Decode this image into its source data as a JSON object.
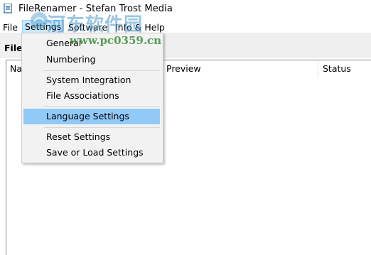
{
  "window": {
    "title": "FileRenamer - Stefan Trost Media"
  },
  "menubar": {
    "items": [
      {
        "label": "File"
      },
      {
        "label": "Settings"
      },
      {
        "label": "Software"
      },
      {
        "label": "Info & Help"
      }
    ]
  },
  "toolbar": {
    "label": "File"
  },
  "table": {
    "columns": [
      "Na",
      "Preview",
      "Status"
    ]
  },
  "settings_menu": {
    "items": [
      {
        "label": "General"
      },
      {
        "label": "Numbering"
      },
      {
        "label": "System Integration"
      },
      {
        "label": "File Associations"
      },
      {
        "label": "Language Settings"
      },
      {
        "label": "Reset Settings"
      },
      {
        "label": "Save or Load Settings"
      }
    ],
    "highlighted": "Language Settings"
  },
  "watermark": {
    "chinese": "河东软件园",
    "url": "www.pc0359.cn"
  },
  "colors": {
    "highlight": "#91c9f7",
    "menu_bg": "#f2f2f2",
    "toolbar_bg": "#f0f0f0"
  }
}
